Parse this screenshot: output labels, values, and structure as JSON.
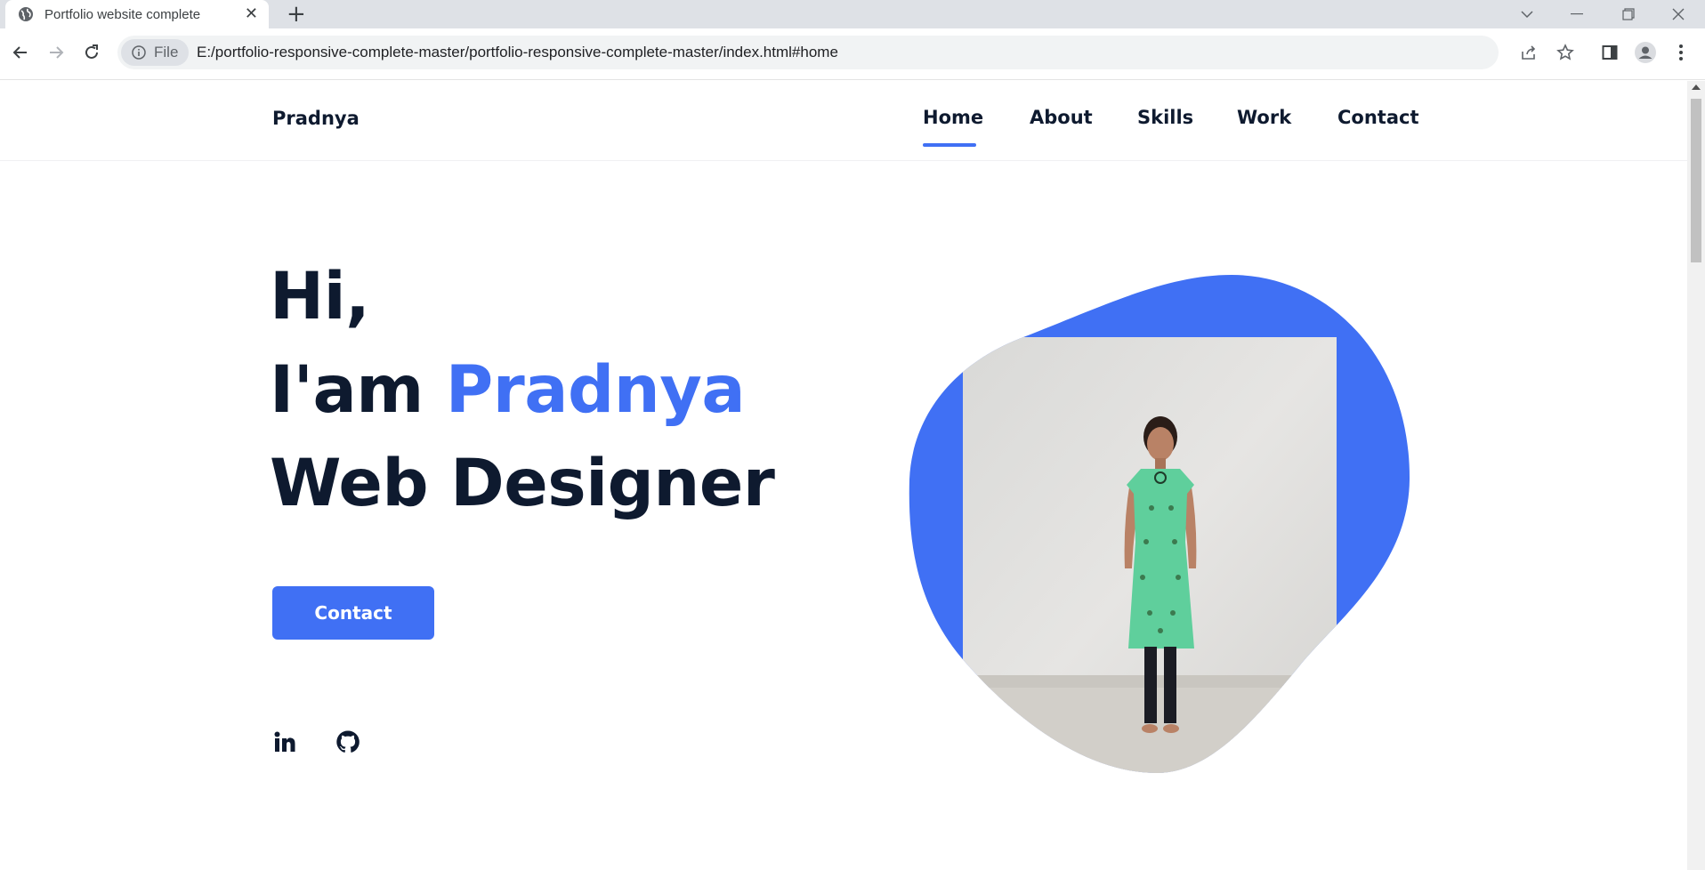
{
  "browser": {
    "tab_title": "Portfolio website complete",
    "tab_close": "✕",
    "new_tab": "+",
    "chip_label": "File",
    "url": "E:/portfolio-responsive-complete-master/portfolio-responsive-complete-master/index.html#home"
  },
  "site": {
    "logo": "Pradnya",
    "nav": {
      "home": "Home",
      "about": "About",
      "skills": "Skills",
      "work": "Work",
      "contact": "Contact"
    },
    "active_nav": "Home",
    "hero": {
      "line1": "Hi,",
      "line2_prefix": "I'am ",
      "line2_name": "Pradnya",
      "line3": "Web Designer",
      "button": "Contact"
    },
    "social_icons": [
      "linkedin-icon",
      "github-icon"
    ]
  },
  "colors": {
    "accent": "#4070f4",
    "text_dark": "#0e1a2f",
    "dress": "#5fcf9c"
  }
}
